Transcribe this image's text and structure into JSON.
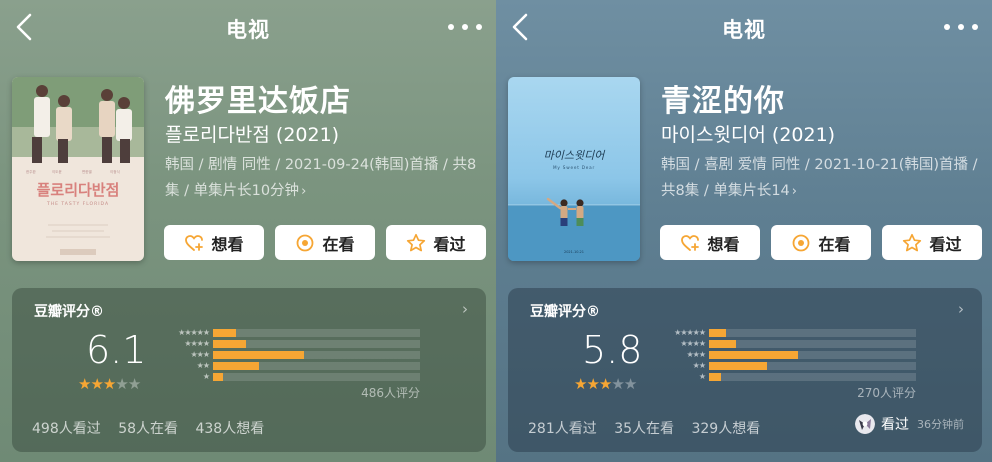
{
  "left": {
    "nav_title": "电视",
    "title": "佛罗里达饭店",
    "subtitle": "플로리다반점 (2021)",
    "meta_line": "韩国 / 剧情 同性 / 2021-09-24(韩国)首播 / 共8集 / 单集片长10分钟",
    "actions": {
      "want": "想看",
      "watching": "在看",
      "watched": "看过"
    },
    "rating": {
      "label": "豆瓣评分®",
      "score": "6.1",
      "stars_filled": 3,
      "distribution": [
        0.11,
        0.16,
        0.44,
        0.22,
        0.05
      ],
      "count_text": "486人评分"
    },
    "stats": {
      "watched": "498人看过",
      "watching": "58人在看",
      "want": "438人想看"
    },
    "poster": {
      "hangul_title": "플로리다반점",
      "eng_subtitle": "THE TASTY FLORIDA"
    }
  },
  "right": {
    "nav_title": "电视",
    "title": "青涩的你",
    "subtitle": "마이스윗디어 (2021)",
    "meta_line": "韩国 / 喜剧 爱情 同性 / 2021-10-21(韩国)首播 / 共8集 / 单集片长14",
    "actions": {
      "want": "想看",
      "watching": "在看",
      "watched": "看过"
    },
    "rating": {
      "label": "豆瓣评分®",
      "score": "5.8",
      "stars_filled": 3,
      "distribution": [
        0.08,
        0.13,
        0.43,
        0.28,
        0.06
      ],
      "count_text": "270人评分"
    },
    "stats": {
      "watched": "281人看过",
      "watching": "35人在看",
      "want": "329人想看"
    },
    "activity": {
      "label": "看过",
      "time": "36分钟前"
    },
    "poster": {
      "hangul_title": "마이스윗디어",
      "eng_subtitle": "My Sweet Dear"
    }
  },
  "colors": {
    "accent": "#f6a634",
    "left_bg": "#7b947f",
    "right_bg": "#5f7f92"
  },
  "icons": [
    "back-icon",
    "more-icon",
    "heart-plus-icon",
    "target-icon",
    "star-outline-icon",
    "chevron-right-icon"
  ]
}
